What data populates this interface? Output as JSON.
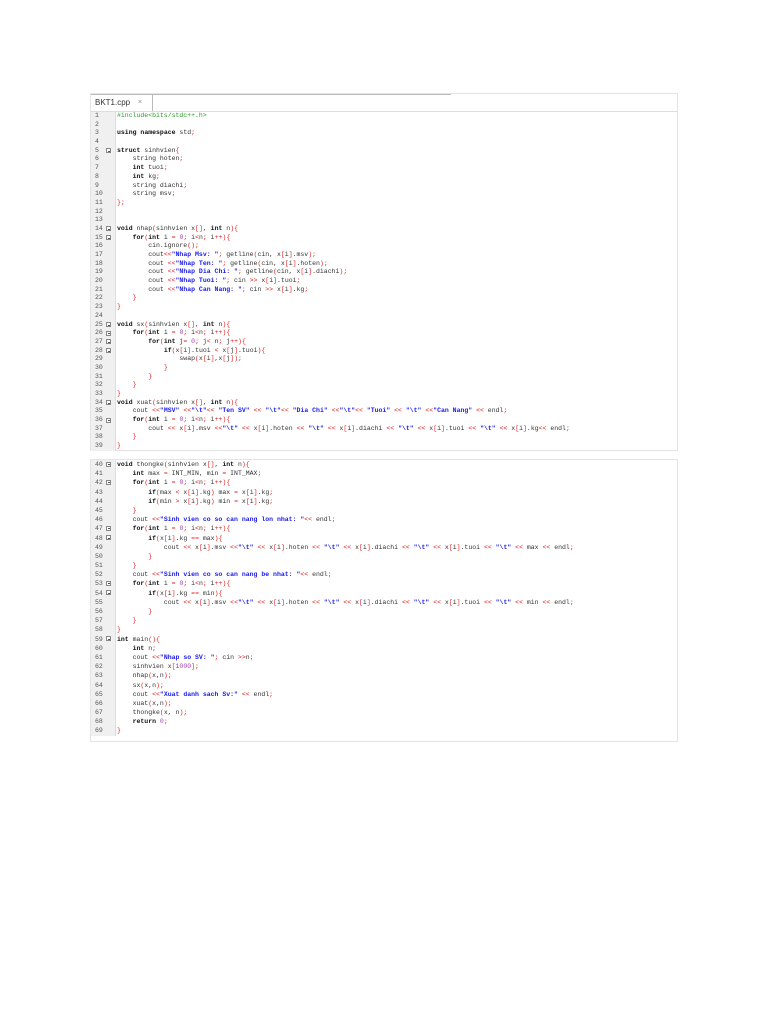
{
  "editor": {
    "tab_label": "BKT1.cpp",
    "tab_close": "×"
  },
  "fold_lines": [
    5,
    14,
    15,
    25,
    26,
    27,
    28,
    34,
    36,
    40,
    42,
    47,
    48,
    53,
    54,
    59
  ],
  "block1": [
    {
      "n": "1",
      "t": "#include<bits/stdc++.h>"
    },
    {
      "n": "2",
      "t": ""
    },
    {
      "n": "3",
      "t": "using namespace std;"
    },
    {
      "n": "4",
      "t": ""
    },
    {
      "n": "5",
      "t": "struct sinhvien{"
    },
    {
      "n": "6",
      "t": "    string hoten;"
    },
    {
      "n": "7",
      "t": "    int tuoi;"
    },
    {
      "n": "8",
      "t": "    int kg;"
    },
    {
      "n": "9",
      "t": "    string diachi;"
    },
    {
      "n": "10",
      "t": "    string msv;"
    },
    {
      "n": "11",
      "t": "};"
    },
    {
      "n": "12",
      "t": ""
    },
    {
      "n": "13",
      "t": ""
    },
    {
      "n": "14",
      "t": "void nhap(sinhvien x[], int n){"
    },
    {
      "n": "15",
      "t": "    for(int i = 0; i<n; i++){"
    },
    {
      "n": "16",
      "t": "        cin.ignore();"
    },
    {
      "n": "17",
      "t": "        cout<<\"Nhap Msv: \"; getline(cin, x[i].msv);"
    },
    {
      "n": "18",
      "t": "        cout <<\"Nhap Ten: \"; getline(cin, x[i].hoten);"
    },
    {
      "n": "19",
      "t": "        cout <<\"Nhap Dia Chi: \"; getline(cin, x[i].diachi);"
    },
    {
      "n": "20",
      "t": "        cout <<\"Nhap Tuoi: \"; cin >> x[i].tuoi;"
    },
    {
      "n": "21",
      "t": "        cout <<\"Nhap Can Nang: \"; cin >> x[i].kg;"
    },
    {
      "n": "22",
      "t": "    }"
    },
    {
      "n": "23",
      "t": "}"
    },
    {
      "n": "24",
      "t": ""
    },
    {
      "n": "25",
      "t": "void sx(sinhvien x[], int n){"
    },
    {
      "n": "26",
      "t": "    for(int i = 0; i<n; i++){"
    },
    {
      "n": "27",
      "t": "        for(int j= 0; j< n; j++){"
    },
    {
      "n": "28",
      "t": "            if(x[i].tuoi < x[j].tuoi){"
    },
    {
      "n": "29",
      "t": "                swap(x[i],x[j]);"
    },
    {
      "n": "30",
      "t": "            }"
    },
    {
      "n": "31",
      "t": "        }"
    },
    {
      "n": "32",
      "t": "    }"
    },
    {
      "n": "33",
      "t": "}"
    },
    {
      "n": "34",
      "t": "void xuat(sinhvien x[], int n){"
    },
    {
      "n": "35",
      "t": "    cout <<\"MSV\" <<\"\\t\"<< \"Ten SV\" << \"\\t\"<< \"Dia Chi\" <<\"\\t\"<< \"Tuoi\" << \"\\t\" <<\"Can Nang\" << endl;"
    },
    {
      "n": "36",
      "t": "    for(int i = 0; i<n; i++){"
    },
    {
      "n": "37",
      "t": "        cout << x[i].msv <<\"\\t\" << x[i].hoten << \"\\t\" << x[i].diachi << \"\\t\" << x[i].tuoi << \"\\t\" << x[i].kg<< endl;"
    },
    {
      "n": "38",
      "t": "    }"
    },
    {
      "n": "39",
      "t": "}"
    }
  ],
  "block2": [
    {
      "n": "40",
      "t": "void thongke(sinhvien x[], int n){"
    },
    {
      "n": "41",
      "t": "    int max = INT_MIN, min = INT_MAX;"
    },
    {
      "n": "42",
      "t": "    for(int i = 0; i<n; i++){"
    },
    {
      "n": "43",
      "t": "        if(max < x[i].kg) max = x[i].kg;"
    },
    {
      "n": "44",
      "t": "        if(min > x[i].kg) min = x[i].kg;"
    },
    {
      "n": "45",
      "t": "    }"
    },
    {
      "n": "46",
      "t": "    cout <<\"Sinh vien co so can nang lon nhat: \"<< endl;"
    },
    {
      "n": "47",
      "t": "    for(int i = 0; i<n; i++){"
    },
    {
      "n": "48",
      "t": "        if(x[i].kg == max){"
    },
    {
      "n": "49",
      "t": "            cout << x[i].msv <<\"\\t\" << x[i].hoten << \"\\t\" << x[i].diachi << \"\\t\" << x[i].tuoi << \"\\t\" << max << endl;"
    },
    {
      "n": "50",
      "t": "        }"
    },
    {
      "n": "51",
      "t": "    }"
    },
    {
      "n": "52",
      "t": "    cout <<\"Sinh vien co so can nang be nhat: \"<< endl;"
    },
    {
      "n": "53",
      "t": "    for(int i = 0; i<n; i++){"
    },
    {
      "n": "54",
      "t": "        if(x[i].kg == min){"
    },
    {
      "n": "55",
      "t": "            cout << x[i].msv <<\"\\t\" << x[i].hoten << \"\\t\" << x[i].diachi << \"\\t\" << x[i].tuoi << \"\\t\" << min << endl;"
    },
    {
      "n": "56",
      "t": "        }"
    },
    {
      "n": "57",
      "t": "    }"
    },
    {
      "n": "58",
      "t": "}"
    },
    {
      "n": "59",
      "t": "int main(){"
    },
    {
      "n": "60",
      "t": "    int n;"
    },
    {
      "n": "61",
      "t": "    cout <<\"Nhap so SV: \"; cin >>n;"
    },
    {
      "n": "62",
      "t": "    sinhvien x[1000];"
    },
    {
      "n": "63",
      "t": "    nhap(x,n);"
    },
    {
      "n": "64",
      "t": "    sx(x,n);"
    },
    {
      "n": "65",
      "t": "    cout <<\"Xuat danh sach Sv:\" << endl;"
    },
    {
      "n": "66",
      "t": "    xuat(x,n);"
    },
    {
      "n": "67",
      "t": "    thongke(x, n);"
    },
    {
      "n": "68",
      "t": "    return 0;"
    },
    {
      "n": "69",
      "t": "}"
    }
  ]
}
